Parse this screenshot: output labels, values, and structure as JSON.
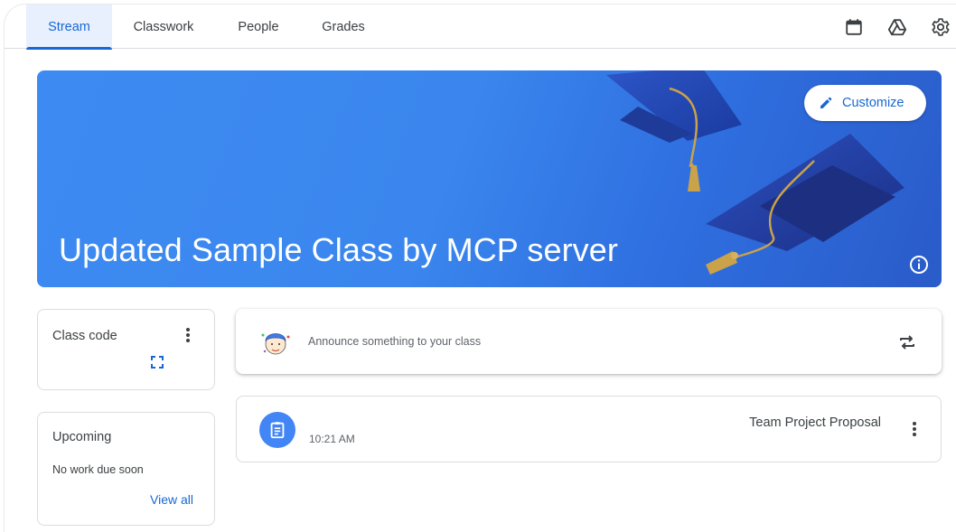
{
  "nav": {
    "tabs": [
      {
        "label": "Stream",
        "active": true
      },
      {
        "label": "Classwork",
        "active": false
      },
      {
        "label": "People",
        "active": false
      },
      {
        "label": "Grades",
        "active": false
      }
    ],
    "icons": [
      "calendar-icon",
      "drive-icon",
      "gear-icon"
    ]
  },
  "banner": {
    "title": "Updated Sample Class by MCP server",
    "customize_label": "Customize",
    "info_icon": "info-icon"
  },
  "class_code": {
    "title": "Class code",
    "menu_icon": "more-vert-icon",
    "expand_icon": "fullscreen-icon"
  },
  "upcoming": {
    "title": "Upcoming",
    "empty_text": "No work due soon",
    "view_all_label": "View all"
  },
  "announce": {
    "placeholder": "Announce something to your class",
    "repost_icon": "repost-icon"
  },
  "posts": [
    {
      "title": "Team Project Proposal",
      "time": "10:21 AM",
      "icon": "assignment-icon"
    }
  ],
  "colors": {
    "accent": "#1967d2",
    "tab_active_bg": "#e8f0fe",
    "banner_blue": "#3d8bf2",
    "post_icon_bg": "#4285f4"
  }
}
